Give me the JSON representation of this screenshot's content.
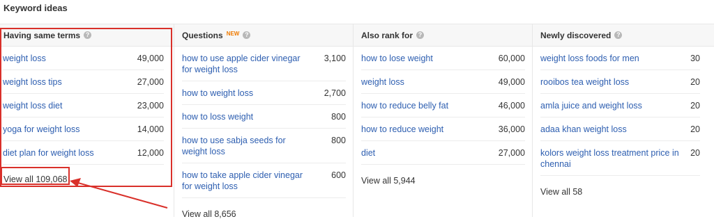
{
  "page": {
    "title": "Keyword ideas"
  },
  "columns": [
    {
      "title": "Having same terms",
      "badge": "",
      "rows": [
        {
          "keyword": "weight loss",
          "volume": "49,000"
        },
        {
          "keyword": "weight loss tips",
          "volume": "27,000"
        },
        {
          "keyword": "weight loss diet",
          "volume": "23,000"
        },
        {
          "keyword": "yoga for weight loss",
          "volume": "14,000"
        },
        {
          "keyword": "diet plan for weight loss",
          "volume": "12,000"
        }
      ],
      "view_all": "View all 109,068"
    },
    {
      "title": "Questions",
      "badge": "NEW",
      "rows": [
        {
          "keyword": "how to use apple cider vinegar for weight loss",
          "volume": "3,100"
        },
        {
          "keyword": "how to weight loss",
          "volume": "2,700"
        },
        {
          "keyword": "how to loss weight",
          "volume": "800"
        },
        {
          "keyword": "how to use sabja seeds for weight loss",
          "volume": "800"
        },
        {
          "keyword": "how to take apple cider vinegar for weight loss",
          "volume": "600"
        }
      ],
      "view_all": "View all 8,656"
    },
    {
      "title": "Also rank for",
      "badge": "",
      "rows": [
        {
          "keyword": "how to lose weight",
          "volume": "60,000"
        },
        {
          "keyword": "weight loss",
          "volume": "49,000"
        },
        {
          "keyword": "how to reduce belly fat",
          "volume": "46,000"
        },
        {
          "keyword": "how to reduce weight",
          "volume": "36,000"
        },
        {
          "keyword": "diet",
          "volume": "27,000"
        }
      ],
      "view_all": "View all 5,944"
    },
    {
      "title": "Newly discovered",
      "badge": "",
      "rows": [
        {
          "keyword": "weight loss foods for men",
          "volume": "30"
        },
        {
          "keyword": "rooibos tea weight loss",
          "volume": "20"
        },
        {
          "keyword": "amla juice and weight loss",
          "volume": "20"
        },
        {
          "keyword": "adaa khan weight loss",
          "volume": "20"
        },
        {
          "keyword": "kolors weight loss treatment price in chennai",
          "volume": "20"
        }
      ],
      "view_all": "View all 58"
    }
  ],
  "icons": {
    "help": "help-icon",
    "arrow": "annotation-arrow"
  },
  "colors": {
    "link": "#2d5eb0",
    "annotation": "#d9302a",
    "new_badge": "#f07b00"
  }
}
